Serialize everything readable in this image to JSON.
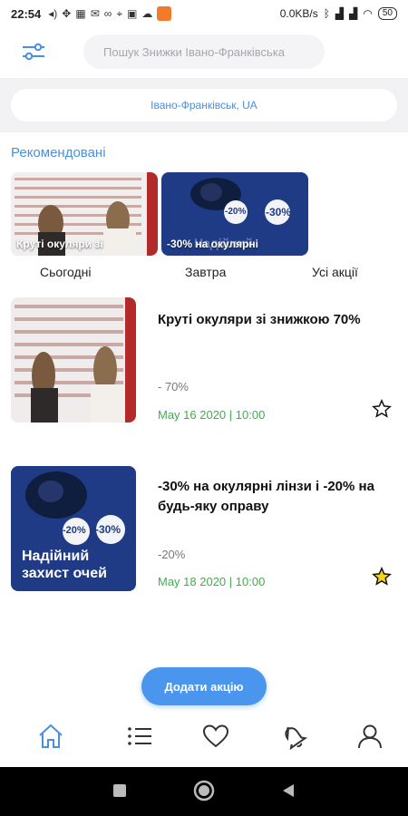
{
  "status_bar": {
    "time": "22:54",
    "left_icons": [
      "volume-icon",
      "move-icon",
      "qr-icon",
      "mail-icon",
      "glasses-icon",
      "location-icon",
      "image-icon",
      "cloud-icon",
      "app-icon"
    ],
    "speed": "0.0KB/s",
    "battery": "50"
  },
  "header": {
    "search_placeholder": "Пошук Знижки Івано-Франківська"
  },
  "location": {
    "label": "Івано-Франківськ, UA"
  },
  "recommended": {
    "title": "Рекомендовані",
    "cards": [
      {
        "caption": "Круті окуляри зі"
      },
      {
        "caption": "-30% на окулярні",
        "badge1": "-20%",
        "badge2": "-30%",
        "back_text": "Надійний"
      }
    ]
  },
  "tabs": [
    {
      "label": "Сьогодні"
    },
    {
      "label": "Завтра"
    },
    {
      "label": "Усі акції"
    }
  ],
  "items": [
    {
      "title": "Круті окуляри зі знижкою 70%",
      "discount": "- 70%",
      "date": "May 16 2020 | 10:00",
      "favorite": false
    },
    {
      "title": "-30% на окулярні лінзи і -20% на будь-яку оправу",
      "discount": "-20%",
      "date": "May 18 2020 | 10:00",
      "favorite": true,
      "img_badge1": "-20%",
      "img_badge2": "-30%",
      "img_text": "Надійний захист очей"
    }
  ],
  "add_button": "Додати акцію",
  "colors": {
    "accent": "#4a8fe0",
    "date_green": "#3fae4c",
    "star_fill": "#f2d21b",
    "promo_navy": "#1f3b86"
  },
  "bottom_nav": [
    "home-icon",
    "list-icon",
    "heart-icon",
    "bell-icon",
    "user-icon"
  ]
}
